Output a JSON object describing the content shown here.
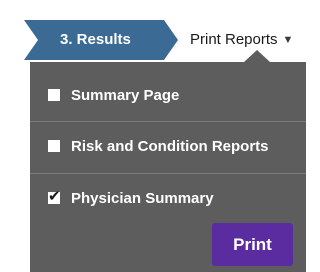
{
  "steps": {
    "current_label": "3. Results"
  },
  "print_menu": {
    "trigger_label": "Print Reports",
    "trigger_icon": "caret-down-icon",
    "options": [
      {
        "label": "Summary Page",
        "checked": false
      },
      {
        "label": "Risk and Condition Reports",
        "checked": false
      },
      {
        "label": "Physician Summary",
        "checked": true
      }
    ],
    "print_button_label": "Print"
  },
  "colors": {
    "step_tab": "#3b6b94",
    "panel": "#5d5d5d",
    "print_button": "#5b2ca0"
  }
}
